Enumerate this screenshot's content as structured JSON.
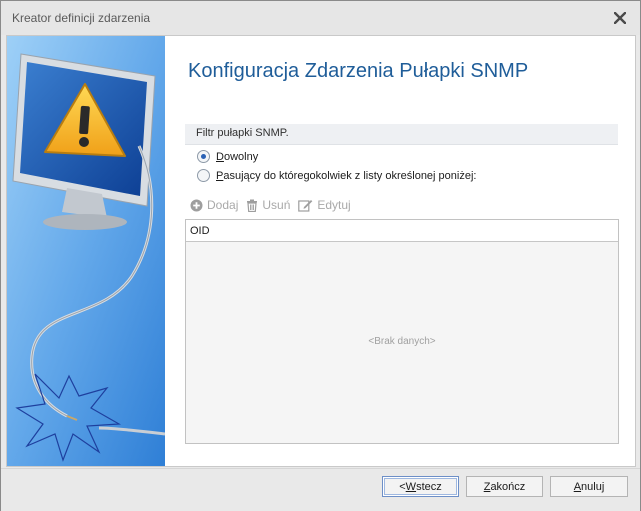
{
  "window": {
    "title": "Kreator definicji zdarzenia",
    "close_icon": "close-icon"
  },
  "page": {
    "heading": "Konfiguracja Zdarzenia Pułapki SNMP"
  },
  "filter": {
    "label": "Filtr pułapki SNMP.",
    "options": [
      {
        "first": "D",
        "rest": "owolny",
        "checked": true
      },
      {
        "first": "P",
        "rest": "asujący do któregokolwiek z listy określonej poniżej:",
        "checked": false
      }
    ]
  },
  "toolbar": {
    "add_label": "Dodaj",
    "remove_label": "Usuń",
    "edit_label": "Edytuj"
  },
  "grid": {
    "columns": [
      "OID"
    ],
    "empty_text": "<Brak danych>"
  },
  "footer": {
    "back": {
      "lead": "< ",
      "key": "W",
      "rest": "stecz"
    },
    "finish": {
      "lead": "",
      "key": "Z",
      "rest": "akończ"
    },
    "cancel": {
      "lead": "",
      "key": "A",
      "rest": "nuluj"
    }
  },
  "colors": {
    "heading": "#1f5d99",
    "panel_blue": "#5aa0e6",
    "warning": "#f5b82a"
  }
}
